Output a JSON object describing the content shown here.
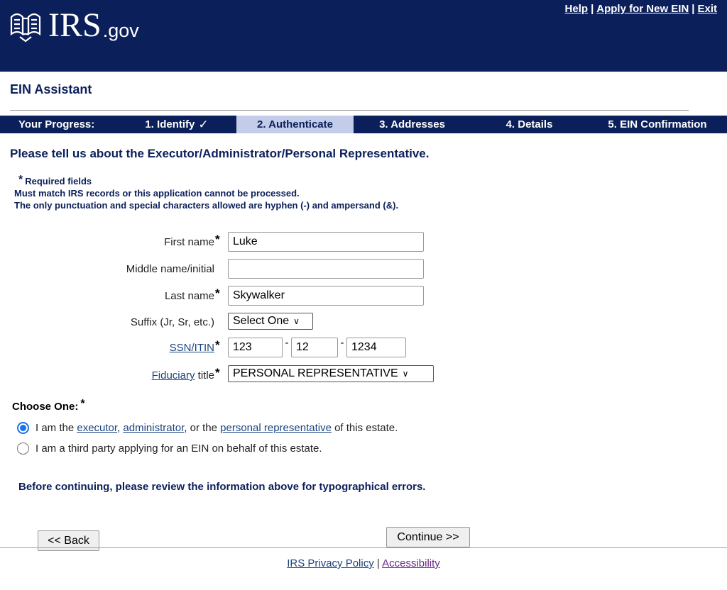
{
  "header": {
    "logo_main": "IRS",
    "logo_gov": ".gov",
    "links": {
      "help": "Help",
      "apply": "Apply for New EIN",
      "exit": "Exit",
      "sep": "|"
    }
  },
  "app_title": "EIN Assistant",
  "progress": {
    "label": "Your Progress:",
    "steps": [
      {
        "label": "1. Identify",
        "done": true
      },
      {
        "label": "2. Authenticate",
        "current": true
      },
      {
        "label": "3. Addresses"
      },
      {
        "label": "4. Details"
      },
      {
        "label": "5. EIN Confirmation"
      }
    ],
    "check_glyph": "✓"
  },
  "heading": "Please tell us about the Executor/Administrator/Personal Representative.",
  "requirements": {
    "star": "*",
    "required": "Required fields",
    "line2": "Must match IRS records or this application cannot be processed.",
    "line3": "The only punctuation and special characters allowed are hyphen (-) and ampersand (&)."
  },
  "form": {
    "first_name": {
      "label": "First name",
      "value": "Luke",
      "required": "*"
    },
    "middle_name": {
      "label": "Middle name/initial",
      "value": ""
    },
    "last_name": {
      "label": "Last name",
      "value": "Skywalker",
      "required": "*"
    },
    "suffix": {
      "label": "Suffix (Jr, Sr, etc.)",
      "value": "Select One"
    },
    "ssn": {
      "link": "SSN/ITIN",
      "required": "*",
      "part1": "123",
      "part2": "12",
      "part3": "1234",
      "dash": "-"
    },
    "fiduciary": {
      "link": "Fiduciary",
      "label_rest": " title",
      "required": "*",
      "value": "PERSONAL REPRESENTATIVE"
    }
  },
  "choose": {
    "label": "Choose One:",
    "star": "*",
    "option1": {
      "pre": "I am the ",
      "link1": "executor",
      "mid1": ", ",
      "link2": "administrator",
      "mid2": ", or the ",
      "link3": "personal representative",
      "post": " of this estate.",
      "selected": true
    },
    "option2": {
      "text": "I am a third party applying for an EIN on behalf of this estate.",
      "selected": false
    }
  },
  "review_note": "Before continuing, please review the information above for typographical errors.",
  "buttons": {
    "back": "<< Back",
    "continue": "Continue >>"
  },
  "footer": {
    "privacy": "IRS Privacy Policy",
    "sep": " | ",
    "accessibility": "Accessibility"
  },
  "colors": {
    "navy": "#0b1f5a",
    "progress_current": "#c3cce8",
    "link": "#1a4480",
    "radio_on": "#1a73e8"
  }
}
